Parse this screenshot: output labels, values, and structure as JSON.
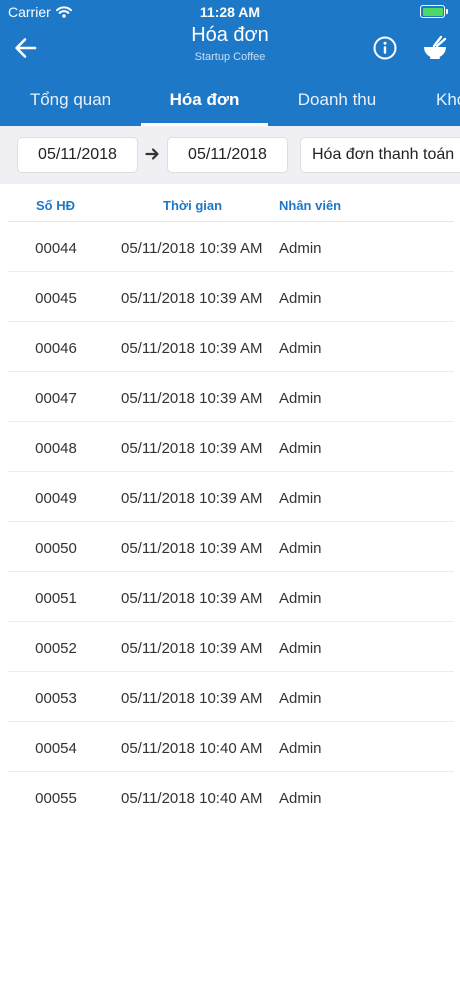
{
  "status_bar": {
    "carrier": "Carrier",
    "time": "11:28 AM"
  },
  "header": {
    "title": "Hóa đơn",
    "subtitle": "Startup Coffee"
  },
  "tabs": [
    {
      "label": "Tổng quan",
      "active": false
    },
    {
      "label": "Hóa đơn",
      "active": true
    },
    {
      "label": "Doanh thu",
      "active": false
    },
    {
      "label": "Kho",
      "active": false
    }
  ],
  "filter": {
    "from_date": "05/11/2018",
    "to_date": "05/11/2018",
    "invoice_type": "Hóa đơn thanh toán"
  },
  "table": {
    "columns": [
      "Số HĐ",
      "Thời gian",
      "Nhân viên"
    ],
    "rows": [
      {
        "number": "00044",
        "time": "05/11/2018 10:39 AM",
        "employee": "Admin"
      },
      {
        "number": "00045",
        "time": "05/11/2018 10:39 AM",
        "employee": "Admin"
      },
      {
        "number": "00046",
        "time": "05/11/2018 10:39 AM",
        "employee": "Admin"
      },
      {
        "number": "00047",
        "time": "05/11/2018 10:39 AM",
        "employee": "Admin"
      },
      {
        "number": "00048",
        "time": "05/11/2018 10:39 AM",
        "employee": "Admin"
      },
      {
        "number": "00049",
        "time": "05/11/2018 10:39 AM",
        "employee": "Admin"
      },
      {
        "number": "00050",
        "time": "05/11/2018 10:39 AM",
        "employee": "Admin"
      },
      {
        "number": "00051",
        "time": "05/11/2018 10:39 AM",
        "employee": "Admin"
      },
      {
        "number": "00052",
        "time": "05/11/2018 10:39 AM",
        "employee": "Admin"
      },
      {
        "number": "00053",
        "time": "05/11/2018 10:39 AM",
        "employee": "Admin"
      },
      {
        "number": "00054",
        "time": "05/11/2018 10:40 AM",
        "employee": "Admin"
      },
      {
        "number": "00055",
        "time": "05/11/2018 10:40 AM",
        "employee": "Admin"
      }
    ]
  },
  "icons": {
    "back": "arrow-left-icon",
    "info": "info-icon",
    "bowl": "bowl-icon",
    "wifi": "wifi-icon",
    "battery": "battery-icon",
    "range_arrow": "arrow-right-icon",
    "dropdown": "chevron-down-icon"
  },
  "colors": {
    "primary": "#1e78c8",
    "filter_background": "#efeff4",
    "header_text": "#1e78c8",
    "battery_fill": "#4cd964"
  }
}
